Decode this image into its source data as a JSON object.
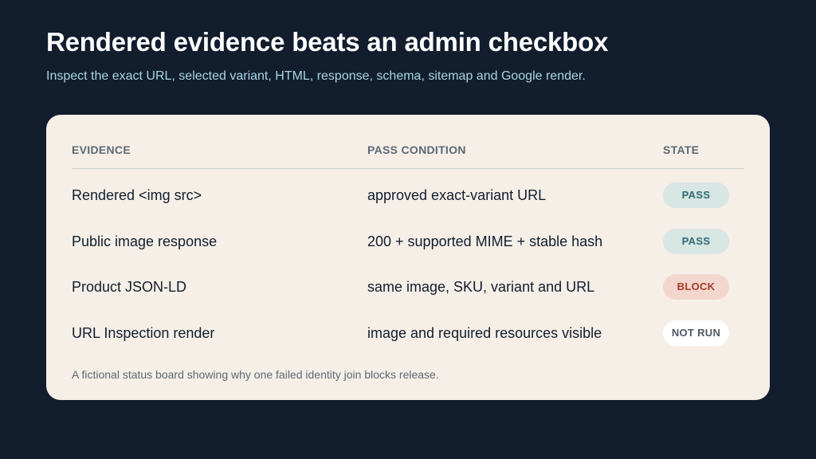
{
  "title": "Rendered evidence beats an admin checkbox",
  "subtitle": "Inspect the exact URL, selected variant, HTML, response, schema, sitemap and Google render.",
  "table": {
    "headers": {
      "evidence": "EVIDENCE",
      "condition": "PASS CONDITION",
      "state": "STATE"
    },
    "rows": [
      {
        "evidence": "Rendered <img src>",
        "condition": "approved exact-variant URL",
        "state": "PASS"
      },
      {
        "evidence": "Public image response",
        "condition": "200 + supported MIME + stable hash",
        "state": "PASS"
      },
      {
        "evidence": "Product JSON-LD",
        "condition": "same image, SKU, variant and URL",
        "state": "BLOCK"
      },
      {
        "evidence": "URL Inspection render",
        "condition": "image and required resources visible",
        "state": "NOT RUN"
      }
    ]
  },
  "footnote": "A fictional status board showing why one failed identity join blocks release.",
  "colors": {
    "background": "#121d2e",
    "card": "#f5efe7",
    "pass": "#2f6b70",
    "block": "#a53b2c",
    "not_run": "#4f5863"
  }
}
